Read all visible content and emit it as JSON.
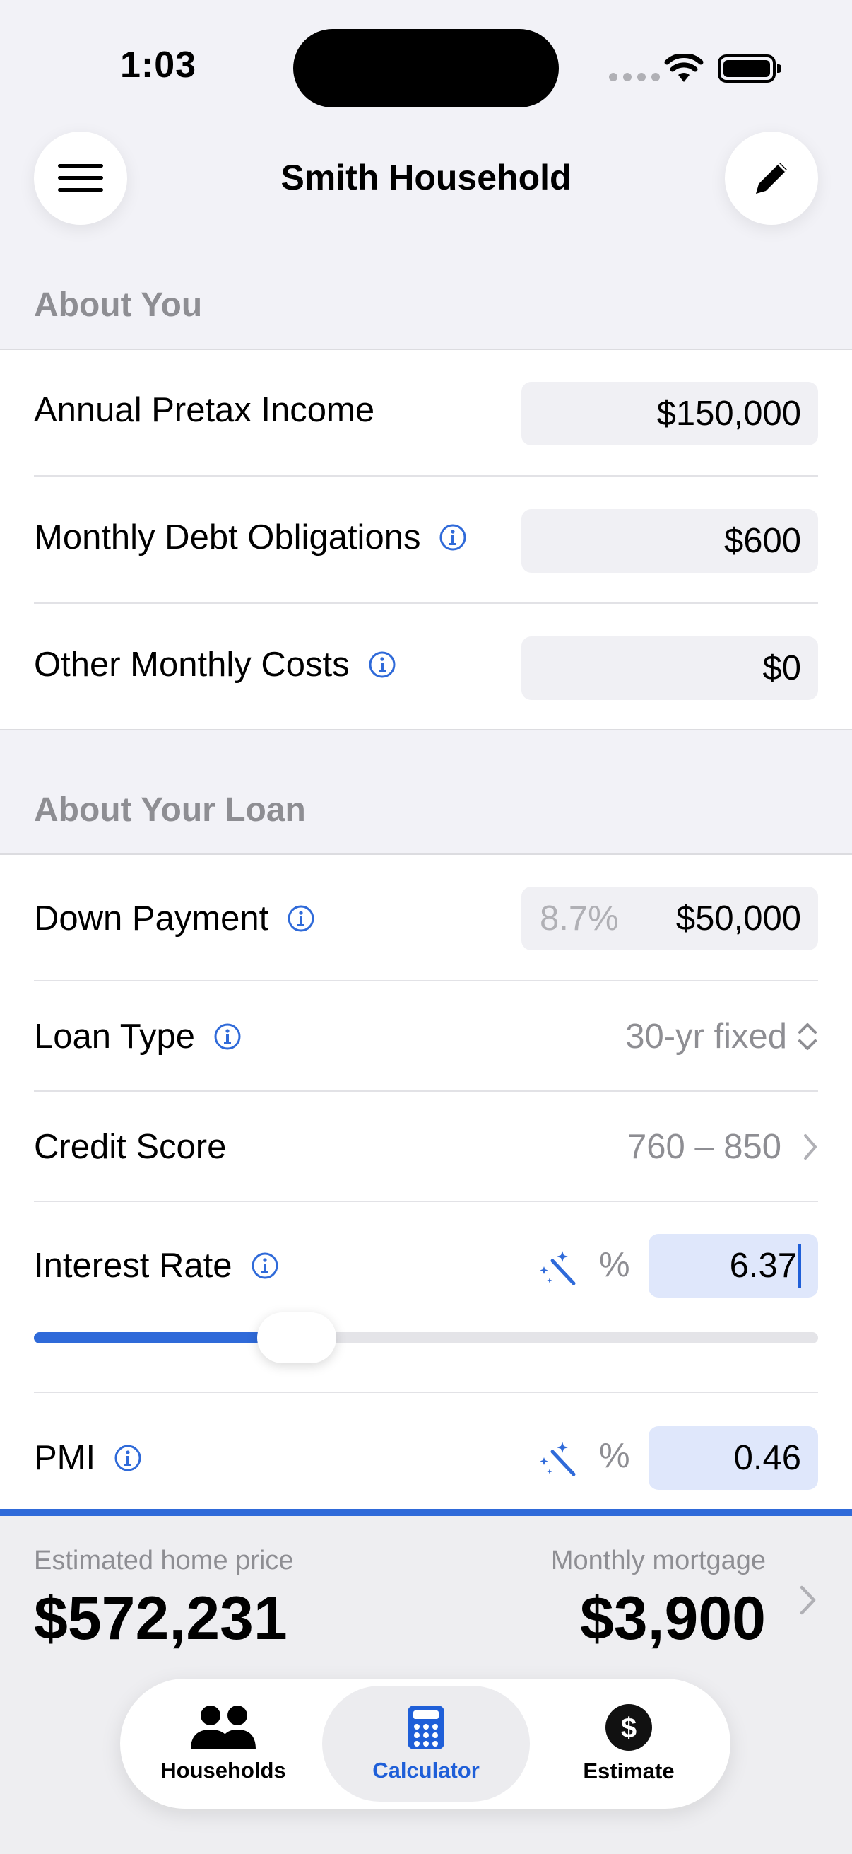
{
  "status_bar": {
    "time": "1:03"
  },
  "header": {
    "title": "Smith Household"
  },
  "about_you": {
    "section_title": "About You",
    "annual_income": {
      "label": "Annual Pretax Income",
      "value": "$150,000"
    },
    "debt": {
      "label": "Monthly Debt Obligations",
      "value": "$600"
    },
    "other_costs": {
      "label": "Other Monthly Costs",
      "value": "$0"
    }
  },
  "about_loan": {
    "section_title": "About Your Loan",
    "down_payment": {
      "label": "Down Payment",
      "percent": "8.7%",
      "value": "$50,000"
    },
    "loan_type": {
      "label": "Loan Type",
      "value": "30-yr fixed"
    },
    "credit_score": {
      "label": "Credit Score",
      "value": "760 – 850"
    },
    "interest_rate": {
      "label": "Interest Rate",
      "unit": "%",
      "value": "6.37",
      "slider_fraction": 0.335
    },
    "pmi": {
      "label": "PMI",
      "unit": "%",
      "value": "0.46"
    }
  },
  "summary": {
    "home_price_label": "Estimated home price",
    "home_price": "$572,231",
    "mortgage_label": "Monthly mortgage",
    "mortgage": "$3,900"
  },
  "tabs": [
    {
      "label": "Households",
      "icon": "people-icon"
    },
    {
      "label": "Calculator",
      "icon": "calculator-icon"
    },
    {
      "label": "Estimate",
      "icon": "dollar-circle-icon"
    }
  ],
  "colors": {
    "accent": "#2f6ad9",
    "field_bg": "#f0f0f4",
    "field_highlight": "#dfe7fb"
  }
}
